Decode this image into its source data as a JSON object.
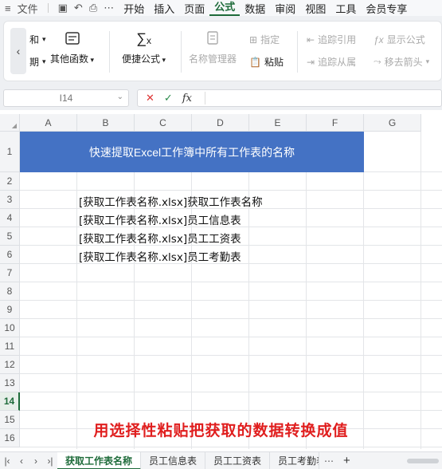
{
  "menu": {
    "items": [
      "文件",
      "开始",
      "插入",
      "页面",
      "公式",
      "数据",
      "审阅",
      "视图",
      "工具",
      "会员专享"
    ],
    "active": "公式"
  },
  "ribbon": {
    "partial_top": "自动求和",
    "partial_top_visible": "和",
    "partial_bottom_visible": "期",
    "other_functions": "其他函数",
    "quick_formula": "便捷公式",
    "name_manager": "名称管理器",
    "specify": "指定",
    "paste": "粘贴",
    "trace_precedents": "追踪引用",
    "show_formulas": "显示公式",
    "trace_dependents": "追踪从属",
    "remove_arrows": "移去箭头"
  },
  "formula_bar": {
    "name_box": "I14",
    "fx_label": "fx"
  },
  "grid": {
    "columns": [
      "A",
      "B",
      "C",
      "D",
      "E",
      "F",
      "G"
    ],
    "rows": [
      "1",
      "2",
      "3",
      "4",
      "5",
      "6",
      "7",
      "8",
      "9",
      "10",
      "11",
      "12",
      "13",
      "14",
      "15",
      "16"
    ],
    "selected_row": "14",
    "title": "快速提取Excel工作簿中所有工作表的名称",
    "cells": [
      "[获取工作表名称.xlsx]获取工作表名称",
      "[获取工作表名称.xlsx]员工信息表",
      "[获取工作表名称.xlsx]员工工资表",
      "[获取工作表名称.xlsx]员工考勤表"
    ],
    "caption": "用选择性粘贴把获取的数据转换成值"
  },
  "sheets": {
    "tabs": [
      "获取工作表名称",
      "员工信息表",
      "员工工资表",
      "员工考勤表"
    ],
    "active": "获取工作表名称"
  },
  "colors": {
    "accent": "#1e6b3a",
    "title_fill": "#4472c4",
    "caption": "#e01e1e"
  }
}
